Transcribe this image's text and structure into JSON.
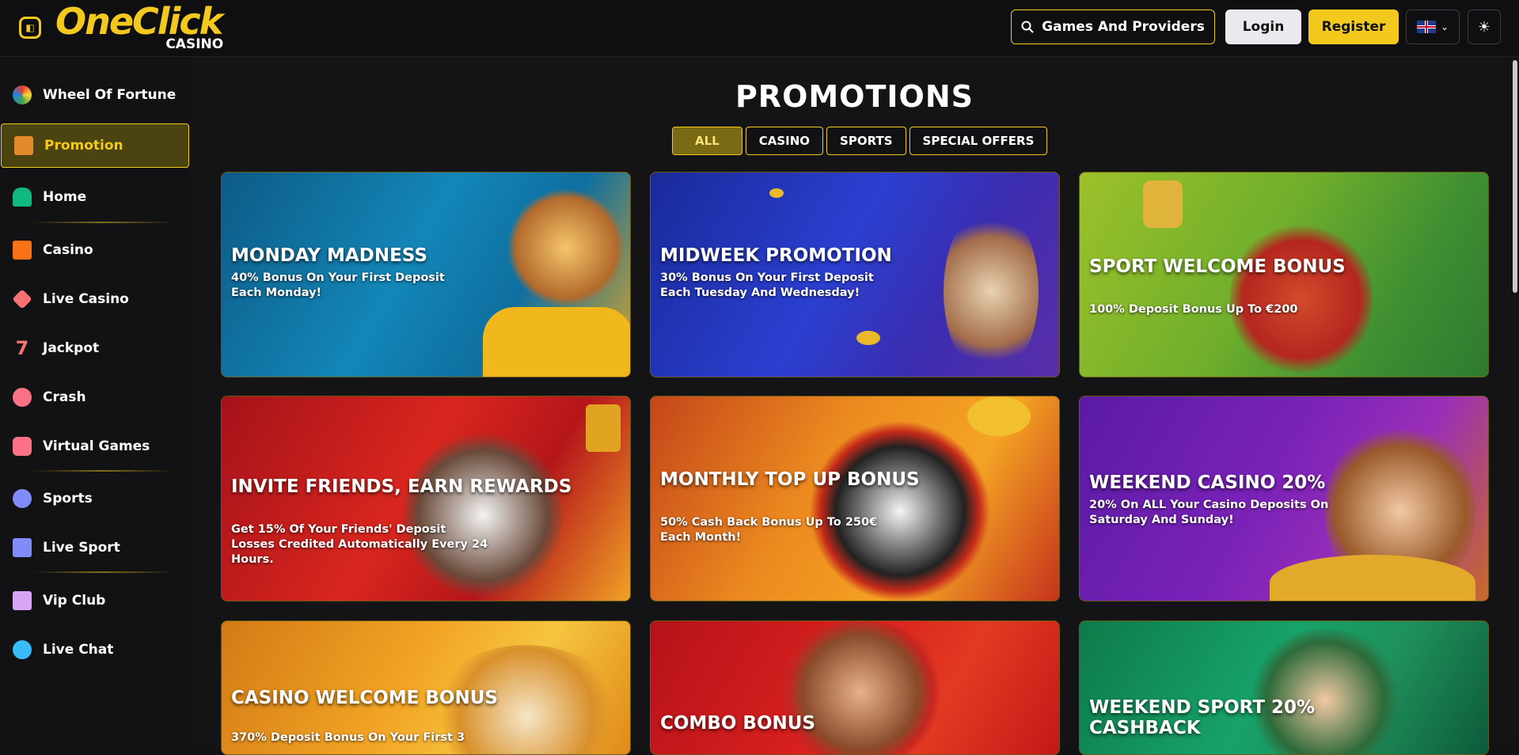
{
  "header": {
    "logo_main": "OneClick",
    "logo_sub": "CASINO",
    "search_label": "Games And Providers",
    "login_label": "Login",
    "register_label": "Register",
    "chevron": "⌄",
    "theme_icon": "☀"
  },
  "sidebar": {
    "items": [
      {
        "label": "Wheel Of Fortune",
        "icon": "wheel-icon"
      },
      {
        "label": "Promotion",
        "icon": "gift-icon"
      },
      {
        "label": "Home",
        "icon": "home-icon"
      },
      {
        "label": "Casino",
        "icon": "slot-icon"
      },
      {
        "label": "Live Casino",
        "icon": "cards-icon"
      },
      {
        "label": "Jackpot",
        "icon": "seven-icon"
      },
      {
        "label": "Crash",
        "icon": "rocket-icon"
      },
      {
        "label": "Virtual Games",
        "icon": "gamepad-icon"
      },
      {
        "label": "Sports",
        "icon": "ball-icon"
      },
      {
        "label": "Live Sport",
        "icon": "monitor-icon"
      },
      {
        "label": "Vip Club",
        "icon": "crown-icon"
      },
      {
        "label": "Live Chat",
        "icon": "chat-icon"
      }
    ]
  },
  "main": {
    "title": "PROMOTIONS",
    "tabs": [
      "ALL",
      "CASINO",
      "SPORTS",
      "SPECIAL OFFERS"
    ],
    "cards": [
      {
        "title": "MONDAY MADNESS",
        "desc": "40% Bonus On Your First Deposit Each Monday!"
      },
      {
        "title": "MIDWEEK PROMOTION",
        "desc": "30% Bonus On Your First Deposit Each Tuesday And Wednesday!"
      },
      {
        "title": "SPORT WELCOME BONUS",
        "desc": "100% Deposit Bonus Up To €200"
      },
      {
        "title": "INVITE FRIENDS, EARN REWARDS",
        "desc": "Get 15% Of Your Friends' Deposit Losses Credited Automatically Every 24 Hours."
      },
      {
        "title": "MONTHLY TOP UP BONUS",
        "desc": "50% Cash Back Bonus Up To 250€ Each Month!"
      },
      {
        "title": "WEEKEND CASINO 20%",
        "desc": "20% On ALL Your Casino Deposits On Saturday And Sunday!"
      },
      {
        "title": "CASINO WELCOME BONUS",
        "desc": "370% Deposit Bonus On Your First 3"
      },
      {
        "title": "COMBO BONUS",
        "desc": ""
      },
      {
        "title": "WEEKEND SPORT 20% CASHBACK",
        "desc": ""
      }
    ]
  },
  "colors": {
    "accent": "#f3c91d",
    "background": "#141416"
  }
}
